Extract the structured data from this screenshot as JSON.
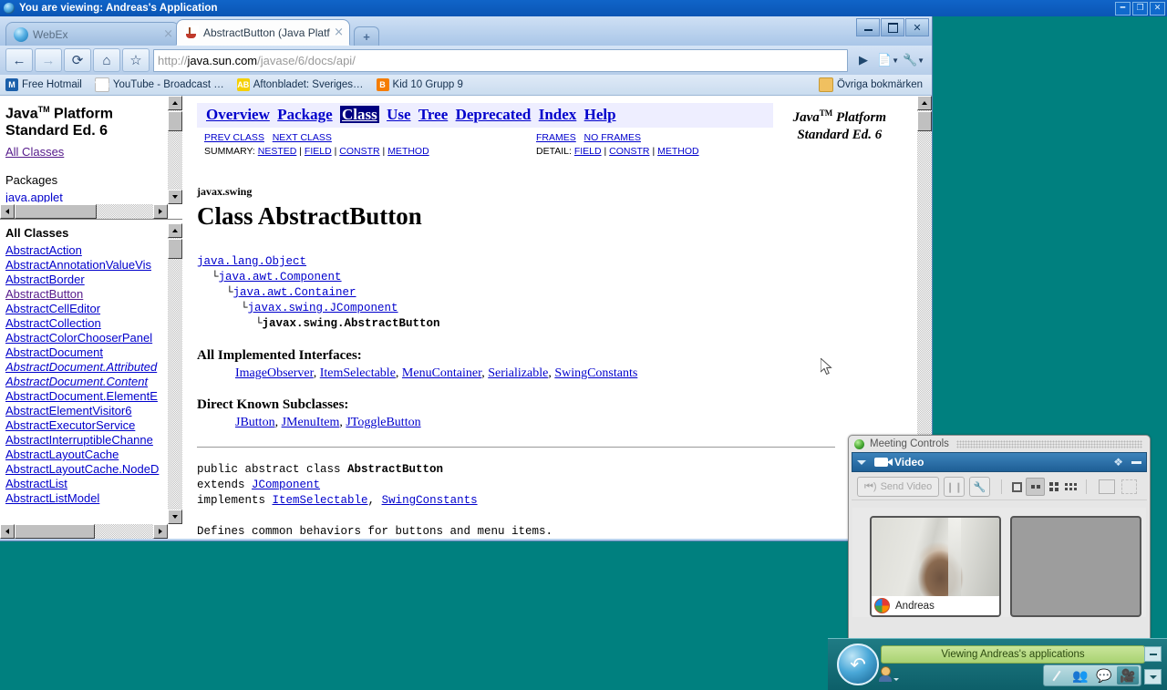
{
  "webex_banner": {
    "title": "You are viewing: Andreas's Application",
    "globe_icon": "globe-icon",
    "buttons": [
      "minimize",
      "restore",
      "close"
    ]
  },
  "browser": {
    "window_buttons": [
      "minimize",
      "restore",
      "close"
    ],
    "tabs": [
      {
        "label": "WebEx",
        "favicon": "globe-icon",
        "active": false,
        "close": "×"
      },
      {
        "label": "AbstractButton (Java Platf…",
        "favicon": "java-icon",
        "active": true,
        "close": "×"
      }
    ],
    "new_tab_label": "+",
    "nav": {
      "back": "←",
      "forward": "→",
      "reload": "⟳",
      "home": "⌂",
      "bookmark_star": "☆",
      "go": "▶",
      "page_menu": "⬚",
      "tools_menu": "🔧"
    },
    "address": {
      "scheme": "http://",
      "host": "java.sun.com",
      "path": "/javase/6/docs/api/",
      "full": "http://java.sun.com/javase/6/docs/api/"
    },
    "bookmarks": [
      {
        "label": "Free Hotmail",
        "icon": "hotmail-icon",
        "glyph": "M"
      },
      {
        "label": "YouTube - Broadcast …",
        "icon": "youtube-icon",
        "glyph": "You"
      },
      {
        "label": "Aftonbladet: Sveriges…",
        "icon": "aftonbladet-icon",
        "glyph": "AB"
      },
      {
        "label": "Kid 10 Grupp 9",
        "icon": "blogger-icon",
        "glyph": "B"
      }
    ],
    "bookmarks_other": {
      "label": "Övriga bokmärken",
      "icon": "folder-icon"
    }
  },
  "javadoc": {
    "left_top": {
      "title_line1": "Java",
      "title_tm": "TM",
      "title_line1b": " Platform",
      "title_line2": "Standard Ed. 6",
      "all_classes_link": "All Classes",
      "packages_header": "Packages",
      "first_package": "java.applet"
    },
    "left_bottom": {
      "header": "All Classes",
      "classes": [
        {
          "name": "AbstractAction",
          "visited": false,
          "italic": false
        },
        {
          "name": "AbstractAnnotationValueVis",
          "visited": false,
          "italic": false
        },
        {
          "name": "AbstractBorder",
          "visited": false,
          "italic": false
        },
        {
          "name": "AbstractButton",
          "visited": true,
          "italic": false
        },
        {
          "name": "AbstractCellEditor",
          "visited": false,
          "italic": false
        },
        {
          "name": "AbstractCollection",
          "visited": false,
          "italic": false
        },
        {
          "name": "AbstractColorChooserPanel",
          "visited": false,
          "italic": false
        },
        {
          "name": "AbstractDocument",
          "visited": false,
          "italic": false
        },
        {
          "name": "AbstractDocument.Attributed",
          "visited": false,
          "italic": true
        },
        {
          "name": "AbstractDocument.Content",
          "visited": false,
          "italic": true
        },
        {
          "name": "AbstractDocument.ElementE",
          "visited": false,
          "italic": false
        },
        {
          "name": "AbstractElementVisitor6",
          "visited": false,
          "italic": false
        },
        {
          "name": "AbstractExecutorService",
          "visited": false,
          "italic": false
        },
        {
          "name": "AbstractInterruptibleChanne",
          "visited": false,
          "italic": false
        },
        {
          "name": "AbstractLayoutCache",
          "visited": false,
          "italic": false
        },
        {
          "name": "AbstractLayoutCache.NodeD",
          "visited": false,
          "italic": false
        },
        {
          "name": "AbstractList",
          "visited": false,
          "italic": false
        },
        {
          "name": "AbstractListModel",
          "visited": false,
          "italic": false
        }
      ]
    },
    "topnav": [
      {
        "label": "Overview",
        "current": false
      },
      {
        "label": "Package",
        "current": false
      },
      {
        "label": "Class",
        "current": true
      },
      {
        "label": "Use",
        "current": false
      },
      {
        "label": "Tree",
        "current": false
      },
      {
        "label": "Deprecated",
        "current": false
      },
      {
        "label": "Index",
        "current": false
      },
      {
        "label": "Help",
        "current": false
      }
    ],
    "brand": {
      "line1": "Java",
      "tm": "TM",
      "line1b": " Platform",
      "line2": "Standard Ed. 6"
    },
    "subnav": {
      "prev_class": "PREV CLASS",
      "next_class": "NEXT CLASS",
      "frames": "FRAMES",
      "no_frames": "NO FRAMES",
      "summary_label": "SUMMARY:",
      "summary_items": [
        "NESTED",
        "FIELD",
        "CONSTR",
        "METHOD"
      ],
      "detail_label": "DETAIL:",
      "detail_items": [
        "FIELD",
        "CONSTR",
        "METHOD"
      ],
      "separator": "|"
    },
    "package_name": "javax.swing",
    "class_title": "Class AbstractButton",
    "hierarchy": [
      {
        "text": "java.lang.Object",
        "link": true,
        "indent": 0
      },
      {
        "text": "java.awt.Component",
        "link": true,
        "indent": 1
      },
      {
        "text": "java.awt.Container",
        "link": true,
        "indent": 2
      },
      {
        "text": "javax.swing.JComponent",
        "link": true,
        "indent": 3
      },
      {
        "text": "javax.swing.AbstractButton",
        "link": false,
        "indent": 4
      }
    ],
    "tree_branch": "└",
    "interfaces_header": "All Implemented Interfaces:",
    "interfaces": [
      "ImageObserver",
      "ItemSelectable",
      "MenuContainer",
      "Serializable",
      "SwingConstants"
    ],
    "subclasses_header": "Direct Known Subclasses:",
    "subclasses": [
      "JButton",
      "JMenuItem",
      "JToggleButton"
    ],
    "declaration": {
      "line1_prefix": "public abstract class ",
      "line1_name": "AbstractButton",
      "line2_prefix": "extends ",
      "line2_link": "JComponent",
      "line3_prefix": "implements ",
      "line3_links": [
        "ItemSelectable",
        "SwingConstants"
      ]
    },
    "clipped_paragraph": "Defines common behaviors for buttons and menu items."
  },
  "meeting_controls": {
    "title": "Meeting Controls",
    "title_icon": "green-globe-icon",
    "panel": {
      "header": "Video",
      "header_icon": "camera-icon",
      "collapse_icon": "caret-down-icon",
      "float_icon": "float-panel-icon",
      "minimize_icon": "minimize-icon"
    },
    "toolbar": {
      "send_video_label": "Send Video",
      "send_video_icon": "speaker-icon",
      "pause_icon": "pause-icon",
      "settings_icon": "wrench-icon",
      "layouts": [
        {
          "name": "layout-single",
          "selected": false
        },
        {
          "name": "layout-two-up",
          "selected": true
        },
        {
          "name": "layout-four-up",
          "selected": false
        },
        {
          "name": "layout-six-up",
          "selected": false
        }
      ],
      "detach_icon": "detach-icon",
      "fullscreen_icon": "fullscreen-icon"
    },
    "videos": [
      {
        "participant": "Andreas",
        "has_feed": true,
        "badge_icon": "webex-ball-icon"
      },
      {
        "participant": "",
        "has_feed": false,
        "badge_icon": ""
      }
    ]
  },
  "status_strip": {
    "status_text": "Viewing Andreas's applications",
    "back_icon": "webex-back-arrow-icon",
    "participants_icon": "participants-icon",
    "minimize_icon": "minimize-icon",
    "dropdown_icon": "caret-down-icon",
    "tool_icons": [
      {
        "name": "annotate-pencil-icon",
        "selected": false
      },
      {
        "name": "participants-panel-icon",
        "selected": false
      },
      {
        "name": "chat-icon",
        "selected": false
      },
      {
        "name": "video-icon",
        "selected": true
      }
    ]
  },
  "colors": {
    "webex_banner": "#0a55b4",
    "desktop": "#00807f",
    "javadoc_nav_current": "#000080",
    "javadoc_nav_bg": "#eeeeff",
    "link": "#0000cc",
    "visited_link": "#551a8b",
    "status_green": "#a9d272"
  }
}
